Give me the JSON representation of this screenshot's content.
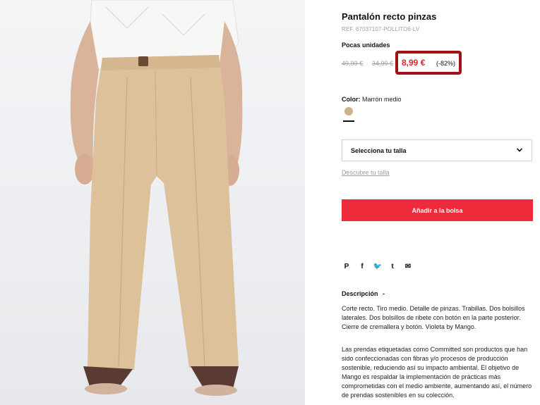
{
  "product": {
    "title": "Pantalón recto pinzas",
    "ref": "REF. 67037107-POLLITO6-LV",
    "stock_notice": "Pocas unidades",
    "old_price_1": "49,99 €",
    "old_price_2": "34,99 €",
    "current_price": "8,99 €",
    "discount": "(-82%)",
    "color_label": "Color:",
    "color_value": "Marrón medio",
    "swatch_color": "#cdb08c"
  },
  "size": {
    "select_label": "Selecciona tu talla",
    "guide_link": "Descubre tu talla"
  },
  "actions": {
    "add_to_bag": "Añadir a la bolsa"
  },
  "share": {
    "icons": [
      "pinterest-icon",
      "facebook-icon",
      "twitter-icon",
      "tumblr-icon",
      "email-icon"
    ],
    "pinterest": "P",
    "facebook": "f",
    "twitter": "🐦",
    "tumblr": "t",
    "email": "✉"
  },
  "description": {
    "title": "Descripción",
    "toggle": "-",
    "paragraph_1": "Corte recto. Tiro medio. Detalle de pinzas. Trabillas. Dos bolsillos laterales. Dos bolsillos de ribete con botón en la parte posterior. Cierre de cremallera y botón. Violeta by Mango.",
    "paragraph_2": "Las prendas etiquetadas como Committed son productos que han sido confeccionadas con fibras y/o procesos de producción sostenible, reduciendo así su impacto ambiental. El objetivo de Mango es respaldar la implementación de prácticas más comprometidas con el medio ambiente, aumentando así, el número de prendas sostenibles en su colección."
  },
  "colors": {
    "accent_red": "#ee2b3a",
    "price_red": "#e0202b",
    "highlight_border": "#a40f17"
  }
}
